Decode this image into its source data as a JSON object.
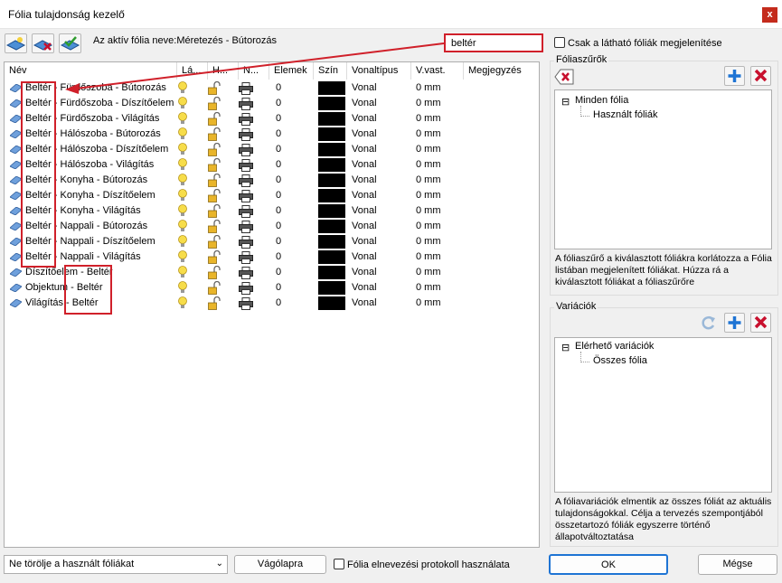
{
  "window": {
    "title": "Fólia tulajdonság kezelő",
    "close_label": "x"
  },
  "toolbar": {
    "active_label": "Az aktív fólia neve:Méretezés - Bútorozás",
    "search_value": "beltér"
  },
  "columns": [
    "Név",
    "Lá...",
    "H...",
    "N...",
    "Elemek",
    "Szín",
    "Vonaltípus",
    "V.vast.",
    "Megjegyzés"
  ],
  "rows": [
    {
      "name": "Beltér - Fürdőszoba - Bútorozás",
      "elements": "0",
      "linetype": "Vonal",
      "thickness": "0 mm"
    },
    {
      "name": "Beltér - Fürdőszoba - Díszítőelem",
      "elements": "0",
      "linetype": "Vonal",
      "thickness": "0 mm"
    },
    {
      "name": "Beltér - Fürdőszoba - Világítás",
      "elements": "0",
      "linetype": "Vonal",
      "thickness": "0 mm"
    },
    {
      "name": "Beltér - Hálószoba - Bútorozás",
      "elements": "0",
      "linetype": "Vonal",
      "thickness": "0 mm"
    },
    {
      "name": "Beltér - Hálószoba - Díszítőelem",
      "elements": "0",
      "linetype": "Vonal",
      "thickness": "0 mm"
    },
    {
      "name": "Beltér - Hálószoba - Világítás",
      "elements": "0",
      "linetype": "Vonal",
      "thickness": "0 mm"
    },
    {
      "name": "Beltér - Konyha - Bútorozás",
      "elements": "0",
      "linetype": "Vonal",
      "thickness": "0 mm"
    },
    {
      "name": "Beltér - Konyha - Díszítőelem",
      "elements": "0",
      "linetype": "Vonal",
      "thickness": "0 mm"
    },
    {
      "name": "Beltér - Konyha - Világítás",
      "elements": "0",
      "linetype": "Vonal",
      "thickness": "0 mm"
    },
    {
      "name": "Beltér - Nappali - Bútorozás",
      "elements": "0",
      "linetype": "Vonal",
      "thickness": "0 mm"
    },
    {
      "name": "Beltér - Nappali - Díszítőelem",
      "elements": "0",
      "linetype": "Vonal",
      "thickness": "0 mm"
    },
    {
      "name": "Beltér - Nappali - Világítás",
      "elements": "0",
      "linetype": "Vonal",
      "thickness": "0 mm"
    },
    {
      "name": "Díszítőelem - Beltér",
      "elements": "0",
      "linetype": "Vonal",
      "thickness": "0 mm"
    },
    {
      "name": "Objektum - Beltér",
      "elements": "0",
      "linetype": "Vonal",
      "thickness": "0 mm"
    },
    {
      "name": "Világítás - Beltér",
      "elements": "0",
      "linetype": "Vonal",
      "thickness": "0 mm"
    }
  ],
  "right": {
    "only_visible_label": "Csak a látható fóliák megjelenítése",
    "filters": {
      "title": "Fóliaszűrők",
      "tree": [
        "Minden fólia",
        "Használt fóliák"
      ],
      "description": "A fóliaszűrő a kiválasztott fóliákra korlátozza a Fólia listában megjelenített fóliákat. Húzza rá a kiválasztott fóliákat a fóliaszűrőre"
    },
    "variations": {
      "title": "Variációk",
      "tree": [
        "Elérhető variációk",
        "Összes fólia"
      ],
      "description": "A fóliavariációk elmentik az összes fóliát az aktuális tulajdonságokkal. Célja a tervezés szempontjából összetartozó fóliák egyszerre történő állapotváltoztatása"
    }
  },
  "bottom": {
    "dropdown_value": "Ne törölje a használt fóliákat",
    "clipboard_label": "Vágólapra",
    "protocol_label": "Fólia elnevezési protokoll használata",
    "ok_label": "OK",
    "cancel_label": "Mégse"
  },
  "colors": {
    "highlight": "#d0202a",
    "swatch": "#000000",
    "accent": "#1e74d4"
  }
}
